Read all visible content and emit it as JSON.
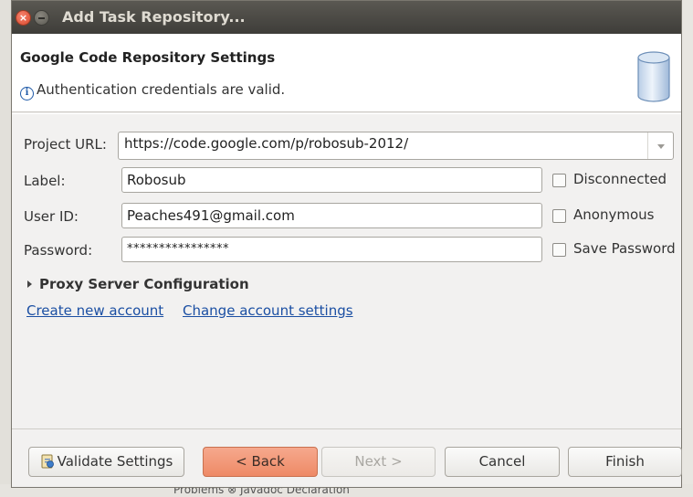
{
  "background": {
    "taskbar_text": "Problems ⊗   Javadoc   Declaration"
  },
  "dialog": {
    "title": "Add Task Repository...",
    "header": {
      "title": "Google Code Repository Settings",
      "message": "Authentication credentials are valid."
    },
    "form": {
      "project_url_label": "Project URL:",
      "project_url_value": "https://code.google.com/p/robosub-2012/",
      "label_label": "Label:",
      "label_value": "Robosub",
      "user_id_label": "User ID:",
      "user_id_value": "Peaches491@gmail.com",
      "password_label": "Password:",
      "password_value": "****************",
      "disconnected_label": "Disconnected",
      "anonymous_label": "Anonymous",
      "save_password_label": "Save Password",
      "proxy_label": "Proxy Server Configuration",
      "create_account_link": "Create new account",
      "change_account_link": "Change account settings"
    },
    "buttons": {
      "validate": "Validate Settings",
      "back": "< Back",
      "next": "Next >",
      "cancel": "Cancel",
      "finish": "Finish"
    },
    "colors": {
      "primary_button": "#ee8a66",
      "link": "#1b4fa3",
      "titlebar": "#3e3d39"
    }
  }
}
